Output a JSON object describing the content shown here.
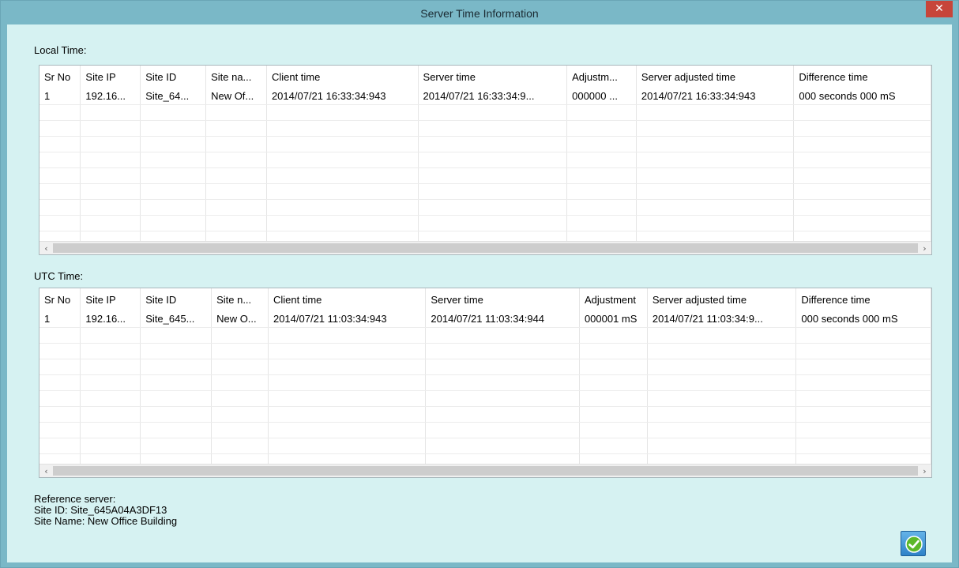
{
  "window": {
    "title": "Server Time Information",
    "close_glyph": "✕"
  },
  "local": {
    "label": "Local Time:",
    "columns": [
      "Sr No",
      "Site IP",
      "Site ID",
      "Site na...",
      "Client time",
      "Server time",
      "Adjustm...",
      "Server adjusted time",
      "Difference time"
    ],
    "rows": [
      [
        "1",
        "192.16...",
        "Site_64...",
        "New Of...",
        "2014/07/21 16:33:34:943",
        "2014/07/21 16:33:34:9...",
        "000000 ...",
        "2014/07/21 16:33:34:943",
        "000 seconds 000 mS"
      ]
    ]
  },
  "utc": {
    "label": "UTC Time:",
    "columns": [
      "Sr No",
      "Site IP",
      "Site ID",
      "Site n...",
      "Client time",
      "Server time",
      "Adjustment",
      "Server adjusted time",
      "Difference time"
    ],
    "rows": [
      [
        "1",
        "192.16...",
        "Site_645...",
        "New O...",
        "2014/07/21 11:03:34:943",
        "2014/07/21 11:03:34:944",
        "000001 mS",
        "2014/07/21 11:03:34:9...",
        "000 seconds 000 mS"
      ]
    ]
  },
  "scroll": {
    "left_glyph": "‹",
    "right_glyph": "›"
  },
  "reference": {
    "heading": "Reference server:",
    "site_id": "Site ID: Site_645A04A3DF13",
    "site_name": "Site Name: New Office Building"
  },
  "ok_button": {
    "icon": "ok-check-icon"
  }
}
